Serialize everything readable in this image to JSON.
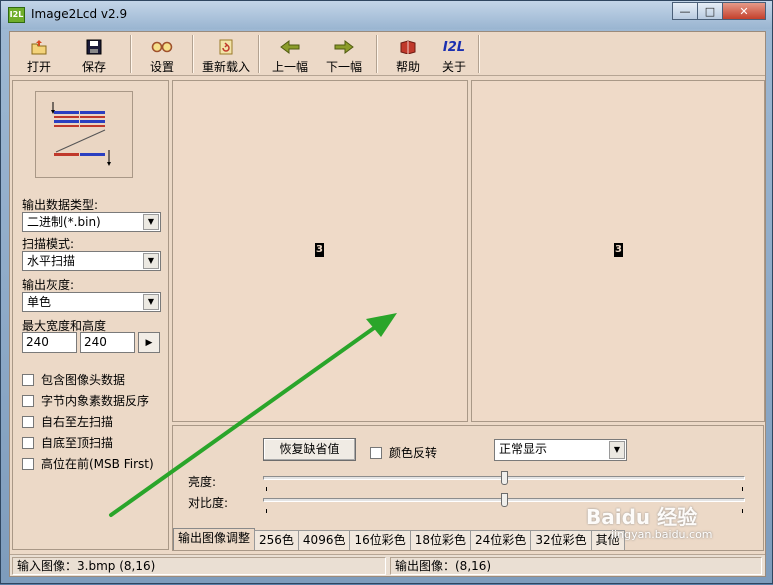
{
  "window": {
    "title": "Image2Lcd v2.9",
    "app_icon_text": "I2L"
  },
  "toolbar": {
    "items": [
      {
        "label": "打开",
        "icon": "open-icon"
      },
      {
        "label": "保存",
        "icon": "save-icon"
      },
      {
        "label": "设置",
        "icon": "settings-glasses-icon"
      },
      {
        "label": "重新载入",
        "icon": "reload-icon"
      },
      {
        "label": "上一幅",
        "icon": "prev-arrow-icon"
      },
      {
        "label": "下一幅",
        "icon": "next-arrow-icon"
      },
      {
        "label": "帮助",
        "icon": "help-book-icon"
      },
      {
        "label": "关于",
        "icon": "about-i2l-icon"
      }
    ],
    "about_glyph": "I2L"
  },
  "left": {
    "output_type_label": "输出数据类型:",
    "output_type_value": "二进制(*.bin)",
    "scan_mode_label": "扫描模式:",
    "scan_mode_value": "水平扫描",
    "gray_label": "输出灰度:",
    "gray_value": "单色",
    "size_label": "最大宽度和高度",
    "width_value": "240",
    "height_value": "240",
    "checkboxes": [
      "包含图像头数据",
      "字节内象素数据反序",
      "自右至左扫描",
      "自底至顶扫描",
      "高位在前(MSB First)"
    ]
  },
  "preview": {
    "left_glyph": "3",
    "right_glyph": "3"
  },
  "adjust": {
    "restore_button": "恢复缺省值",
    "invert_label": "颜色反转",
    "display_mode_value": "正常显示",
    "brightness_label": "亮度:",
    "contrast_label": "对比度:",
    "brightness_level": 0.5,
    "contrast_level": 0.5
  },
  "tabs": [
    "输出图像调整",
    "256色",
    "4096色",
    "16位彩色",
    "18位彩色",
    "24位彩色",
    "32位彩色",
    "其他"
  ],
  "status": {
    "input_image": "输入图像：3.bmp (8,16)",
    "output_image": "输出图像：(8,16)"
  },
  "watermark": {
    "brand": "Baidu 经验",
    "url": "jingyan.baidu.com"
  },
  "colors": {
    "client_bg": "#ecd9c7",
    "arrow_green": "#2aa52a",
    "title_bar": "#9ab5d1"
  }
}
